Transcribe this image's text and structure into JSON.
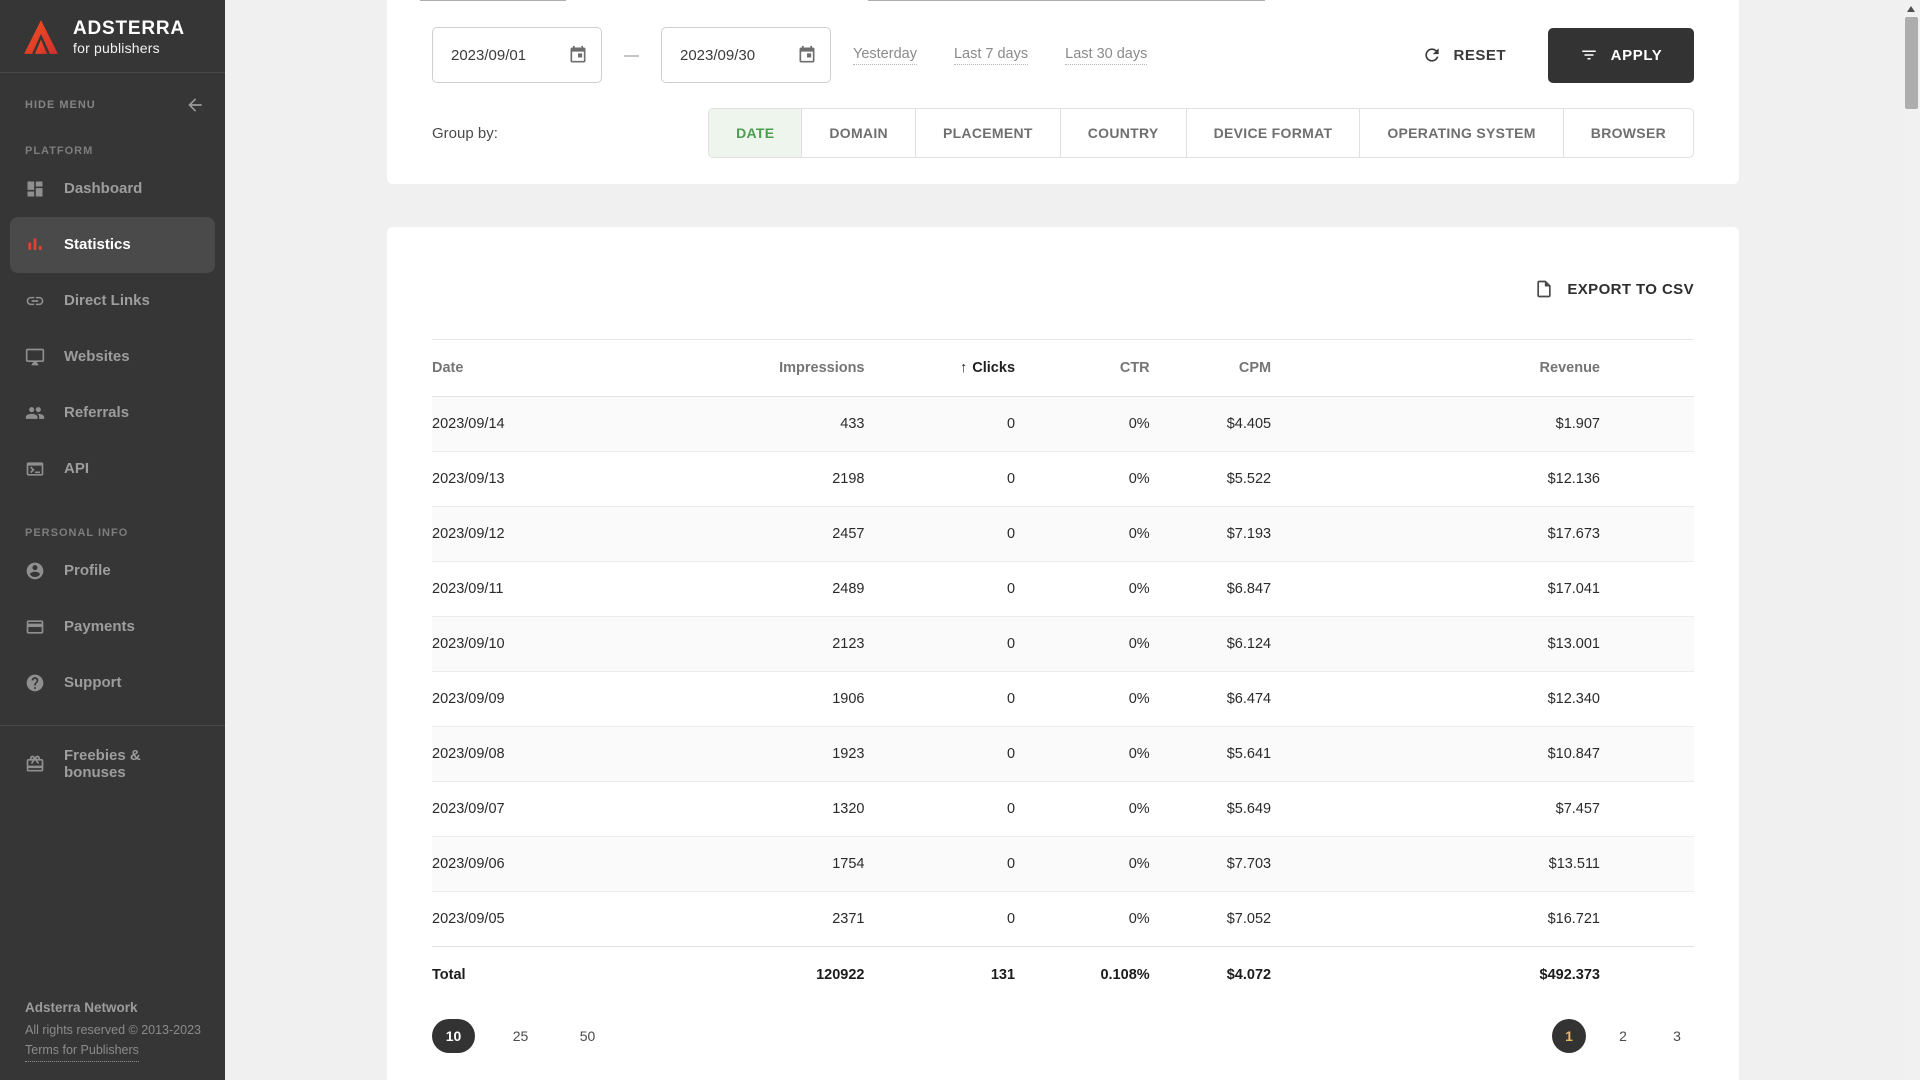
{
  "brand": {
    "name": "ADSTERRA",
    "tagline": "for publishers"
  },
  "sidebar": {
    "hide_menu_label": "HIDE MENU",
    "sections": [
      {
        "label": "PLATFORM",
        "items": [
          {
            "label": "Dashboard",
            "icon": "dashboard-icon",
            "active": false
          },
          {
            "label": "Statistics",
            "icon": "bar-chart-icon",
            "active": true
          },
          {
            "label": "Direct Links",
            "icon": "link-icon",
            "active": false
          },
          {
            "label": "Websites",
            "icon": "monitor-icon",
            "active": false
          },
          {
            "label": "Referrals",
            "icon": "people-icon",
            "active": false
          },
          {
            "label": "API",
            "icon": "terminal-icon",
            "active": false
          }
        ]
      },
      {
        "label": "PERSONAL INFO",
        "items": [
          {
            "label": "Profile",
            "icon": "person-icon",
            "active": false
          },
          {
            "label": "Payments",
            "icon": "credit-card-icon",
            "active": false
          },
          {
            "label": "Support",
            "icon": "help-icon",
            "active": false
          }
        ]
      }
    ],
    "extra_items": [
      {
        "label": "Freebies & bonuses",
        "icon": "gift-icon",
        "active": false
      }
    ],
    "footer": {
      "network": "Adsterra Network",
      "rights": "All rights reserved © 2013-2023",
      "terms_link": "Terms for Publishers"
    }
  },
  "filters": {
    "date_from": "2023/09/01",
    "date_to": "2023/09/30",
    "range_separator": "—",
    "quick_links": [
      "Yesterday",
      "Last 7 days",
      "Last 30 days"
    ],
    "reset_label": "RESET",
    "apply_label": "APPLY",
    "group_by_label": "Group by:",
    "group_tabs": [
      {
        "label": "DATE",
        "active": true
      },
      {
        "label": "DOMAIN",
        "active": false
      },
      {
        "label": "PLACEMENT",
        "active": false
      },
      {
        "label": "COUNTRY",
        "active": false
      },
      {
        "label": "DEVICE FORMAT",
        "active": false
      },
      {
        "label": "OPERATING SYSTEM",
        "active": false
      },
      {
        "label": "BROWSER",
        "active": false
      }
    ]
  },
  "table": {
    "export_label": "EXPORT TO CSV",
    "columns": [
      "Date",
      "Impressions",
      "Clicks",
      "CTR",
      "CPM",
      "Revenue"
    ],
    "sorted_column": "Clicks",
    "sort_indicator": "↑",
    "rows": [
      {
        "date": "2023/09/14",
        "impressions": "433",
        "clicks": "0",
        "ctr": "0%",
        "cpm": "$4.405",
        "revenue": "$1.907"
      },
      {
        "date": "2023/09/13",
        "impressions": "2198",
        "clicks": "0",
        "ctr": "0%",
        "cpm": "$5.522",
        "revenue": "$12.136"
      },
      {
        "date": "2023/09/12",
        "impressions": "2457",
        "clicks": "0",
        "ctr": "0%",
        "cpm": "$7.193",
        "revenue": "$17.673"
      },
      {
        "date": "2023/09/11",
        "impressions": "2489",
        "clicks": "0",
        "ctr": "0%",
        "cpm": "$6.847",
        "revenue": "$17.041"
      },
      {
        "date": "2023/09/10",
        "impressions": "2123",
        "clicks": "0",
        "ctr": "0%",
        "cpm": "$6.124",
        "revenue": "$13.001"
      },
      {
        "date": "2023/09/09",
        "impressions": "1906",
        "clicks": "0",
        "ctr": "0%",
        "cpm": "$6.474",
        "revenue": "$12.340"
      },
      {
        "date": "2023/09/08",
        "impressions": "1923",
        "clicks": "0",
        "ctr": "0%",
        "cpm": "$5.641",
        "revenue": "$10.847"
      },
      {
        "date": "2023/09/07",
        "impressions": "1320",
        "clicks": "0",
        "ctr": "0%",
        "cpm": "$5.649",
        "revenue": "$7.457"
      },
      {
        "date": "2023/09/06",
        "impressions": "1754",
        "clicks": "0",
        "ctr": "0%",
        "cpm": "$7.703",
        "revenue": "$13.511"
      },
      {
        "date": "2023/09/05",
        "impressions": "2371",
        "clicks": "0",
        "ctr": "0%",
        "cpm": "$7.052",
        "revenue": "$16.721"
      }
    ],
    "total": {
      "date": "Total",
      "impressions": "120922",
      "clicks": "131",
      "ctr": "0.108%",
      "cpm": "$4.072",
      "revenue": "$492.373"
    }
  },
  "pagination": {
    "page_sizes": [
      "10",
      "25",
      "50"
    ],
    "active_size": "10",
    "pages": [
      "1",
      "2",
      "3"
    ],
    "active_page": "1"
  },
  "colors": {
    "sidebar_bg": "#363636",
    "sidebar_active_bg": "#4a4a4a",
    "accent_red": "#e0442e",
    "tab_active_green": "#4a9d4e",
    "tab_active_bg": "#edf5ed",
    "dark_button": "#333333",
    "active_page_text": "#e6bd5e",
    "page_bg": "#f0f0f0"
  }
}
